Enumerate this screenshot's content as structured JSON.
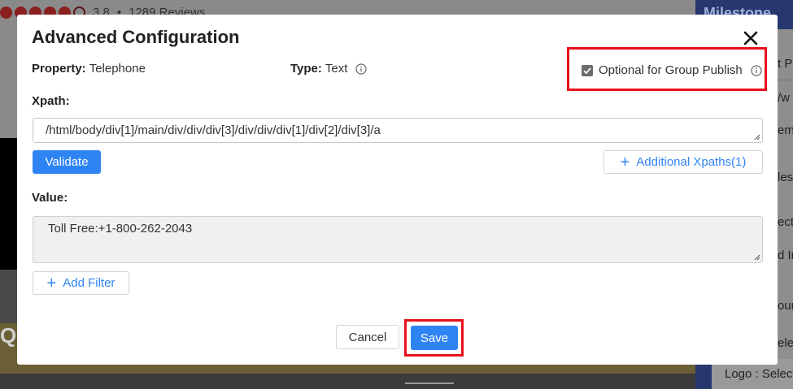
{
  "background": {
    "rating_value": "3.8",
    "rating_separator": "•",
    "reviews": "1289 Reviews",
    "left_letter": "Q",
    "brand": "Milestone",
    "side_fragments": [
      "t P",
      "/w",
      "em",
      "les",
      "ect",
      "d In",
      "our",
      "ele"
    ],
    "logo_select": "Logo : Select"
  },
  "modal": {
    "title": "Advanced Configuration",
    "property_label": "Property:",
    "property_value": "Telephone",
    "type_label": "Type:",
    "type_value": "Text",
    "optional_label": "Optional for Group Publish",
    "optional_checked": true,
    "xpath_label": "Xpath:",
    "xpath_value": "/html/body/div[1]/main/div/div/div[3]/div/div/div[1]/div[2]/div[3]/a",
    "validate_label": "Validate",
    "additional_xpaths_label": "Additional Xpaths(1)",
    "value_label": "Value:",
    "value_text": "Toll Free:+1-800-262-2043",
    "add_filter_label": "Add Filter",
    "cancel_label": "Cancel",
    "save_label": "Save"
  },
  "colors": {
    "primary": "#2f84f4",
    "highlight": "#e8101b",
    "overlay": "#7d7d7d"
  },
  "icons": [
    "close-icon",
    "info-icon",
    "checkbox-check-icon",
    "plus-icon",
    "resize-grip-icon"
  ]
}
